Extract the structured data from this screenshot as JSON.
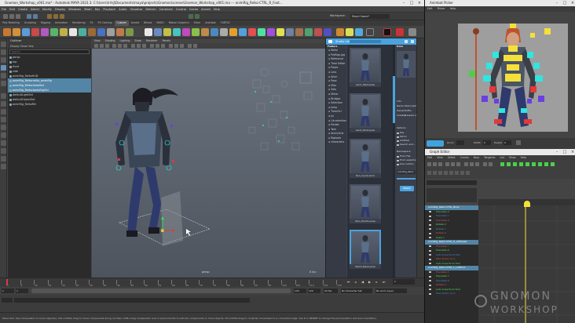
{
  "maya": {
    "title": "Gnomon_Workshop_v001.ma* - Autodesk MAYA 2023.3: C:\\Users\\lrrlsJ\\Documents\\maya\\projects\\Gnomon\\scenes\\Gnomon_Workshop_v001.ma  ---  animRig_Reiko:CTRL_R_Foot...",
    "menus": [
      "File",
      "Edit",
      "Create",
      "Select",
      "Modify",
      "Display",
      "Windows",
      "Mash",
      "Key",
      "Playback",
      "Audio",
      "Visualize",
      "Deform",
      "Constrain",
      "Control",
      "Cache",
      "Arnold",
      "Help"
    ],
    "workspace_label": "Workspace:",
    "workspace_value": "Maya Classic*",
    "shelf_tabs": [
      "Poly Modeling",
      "Sculpting",
      "Rigging",
      "Animation",
      "Rendering",
      "FX",
      "FX Caching",
      "Custom",
      "Arnold",
      "Bifrost",
      "MASH",
      "Motion Graphics",
      "XGen",
      "Animbot",
      "TURTLE"
    ],
    "active_shelf": "Custom"
  },
  "outliner": {
    "title": "Outliner",
    "menu": "Display  Show  Help",
    "search_placeholder": "Search...",
    "rows": [
      {
        "label": "persp",
        "selected": false
      },
      {
        "label": "top",
        "selected": false
      },
      {
        "label": "front",
        "selected": false
      },
      {
        "label": "side",
        "selected": false
      },
      {
        "label": "animRig_ReikoHUD",
        "selected": false
      },
      {
        "label": "animRig_Reiko:reiko_animRig",
        "selected": true
      },
      {
        "label": "animRig_Reiko:headSet",
        "selected": true
      },
      {
        "label": "animRig_Reiko:bodyRigCtrl",
        "selected": true
      },
      {
        "label": "defaultLightSet",
        "selected": false
      },
      {
        "label": "defaultObjectSet",
        "selected": false
      },
      {
        "label": "animRig_ReikoRN",
        "selected": false
      }
    ]
  },
  "viewport": {
    "menus": [
      "View",
      "Shading",
      "Lighting",
      "Show",
      "Renderer",
      "Panels"
    ],
    "camera": "persp",
    "fps": "8 fps"
  },
  "studio_library": {
    "title": "Studio Library",
    "folders_title": "Folders",
    "folders": [
      "Reiko",
      "ProRigs.jpg",
      "Reference",
      "Time Editor",
      "Poses",
      "Locs",
      "Anim",
      "Pose",
      "Misc",
      "Sets",
      "Mirror",
      "Bridges",
      "Selection",
      "Jump",
      "TimeCtrl",
      "Jul",
      "Lib.selection",
      "Pocket",
      "Tech",
      "Anim/ctrls",
      "Rigtools",
      "characters"
    ],
    "items": [
      {
        "caption": "Land_Start.pose",
        "selected": false
      },
      {
        "caption": "Land_Strut.pose",
        "selected": false
      },
      {
        "caption": "Run_Cycle.anim",
        "selected": false
      },
      {
        "caption": "Spin_Pivot1.pose",
        "selected": false
      },
      {
        "caption": "Stand_Base.pose",
        "selected": true
      }
    ],
    "pose_panel": {
      "title": "Pose",
      "info_label": "Info",
      "name_label": "Name",
      "name_value": "Stand_Relax.po",
      "owner_label": "Owner",
      "owner_value": "flufflu",
      "created_label": "Created",
      "created_value": "2 weeks ago",
      "options_label": "Options",
      "options": [
        "Key",
        "Mirror",
        "Additive",
        "Search and..."
      ],
      "namespace_label": "Namespace",
      "namespace_options": [
        "From File",
        "From selection",
        "Use custom"
      ],
      "namespace_value": "animRig_Reiko",
      "apply_label": "Apply"
    }
  },
  "timeslider": {
    "ticks": [
      "1",
      "5",
      "10",
      "15",
      "20",
      "25",
      "30",
      "35",
      "40",
      "45",
      "50",
      "55",
      "60",
      "65",
      "70",
      "75",
      "80",
      "85",
      "90",
      "95",
      "100",
      "105",
      "110",
      "115",
      "120"
    ],
    "start": "1",
    "end": "120",
    "range_start": "1",
    "range_end": "120",
    "current": "1",
    "fps": "24 fps",
    "char_set": "No Character Set",
    "anim_layer": "No Anim Layer"
  },
  "help_line": "Move Tool: Use manipulator to move object(s). Ctrl+middle drag to move components along normals. Shift+drag manipulator axis or plane handle to extrude components or clone objects. Ctrl+Shift+drag to constrain movement to a connected edge. Use D or INSERT to change the pivot position and axis orientation.",
  "picker": {
    "title": "Animbot Picker",
    "menus": [
      "Edit",
      "Picker",
      "Help"
    ],
    "tools": {
      "zoom_label": "Zoom",
      "width_label": "Width",
      "height_label": "Height",
      "width_value": "0",
      "height_value": "0"
    }
  },
  "graph_editor": {
    "title": "Graph Editor",
    "menus": [
      "Edit",
      "View",
      "Select",
      "Curves",
      "Keys",
      "Tangents",
      "List",
      "Show",
      "Help"
    ],
    "curve_rows": [
      {
        "label": "animRig_Reiko:CTRL_Body",
        "selected": true
      },
      {
        "label": "Translate X",
        "selected": false
      },
      {
        "label": "Translate Y",
        "selected": false
      },
      {
        "label": "Translate Z",
        "selected": false
      },
      {
        "label": "Rotate X",
        "selected": false
      },
      {
        "label": "Rotate Y",
        "selected": false
      },
      {
        "label": "Rotate Z",
        "selected": false
      },
      {
        "label": "Scale Y",
        "selected": false
      },
      {
        "label": "animRig_Reiko:CTRL_R_Leftweeb",
        "selected": true
      },
      {
        "label": "Translate Y",
        "selected": false
      },
      {
        "label": "Translate Z",
        "selected": false
      },
      {
        "label": "Auto Knee Pivot Trail",
        "selected": false
      },
      {
        "label": "Pole Vector Lock",
        "selected": false
      },
      {
        "label": "Auto Knee Pivot Trail",
        "selected": false
      },
      {
        "label": "animRig_Reiko:CTRL_L_LeftFoot",
        "selected": true
      },
      {
        "label": "Translate X",
        "selected": false
      },
      {
        "label": "Translate Y",
        "selected": false
      },
      {
        "label": "Translate Z",
        "selected": false
      },
      {
        "label": "Rotate X",
        "selected": false
      },
      {
        "label": "Auto Knee Pivot Trail",
        "selected": false
      },
      {
        "label": "Pole Vector Lock",
        "selected": false
      }
    ]
  },
  "watermark": {
    "line1": "GNOMON",
    "line2": "WORKSHOP"
  },
  "colors": {
    "maya_selection": "#5285a6",
    "studio_accent": "#4aa3df",
    "picker_bg": "#9e9e9e",
    "ctrl_yellow": "#f5e03a",
    "ctrl_cyan": "#2fe6e0",
    "ctrl_purple": "#6b3fe0",
    "ctrl_red": "#e03a3a"
  }
}
